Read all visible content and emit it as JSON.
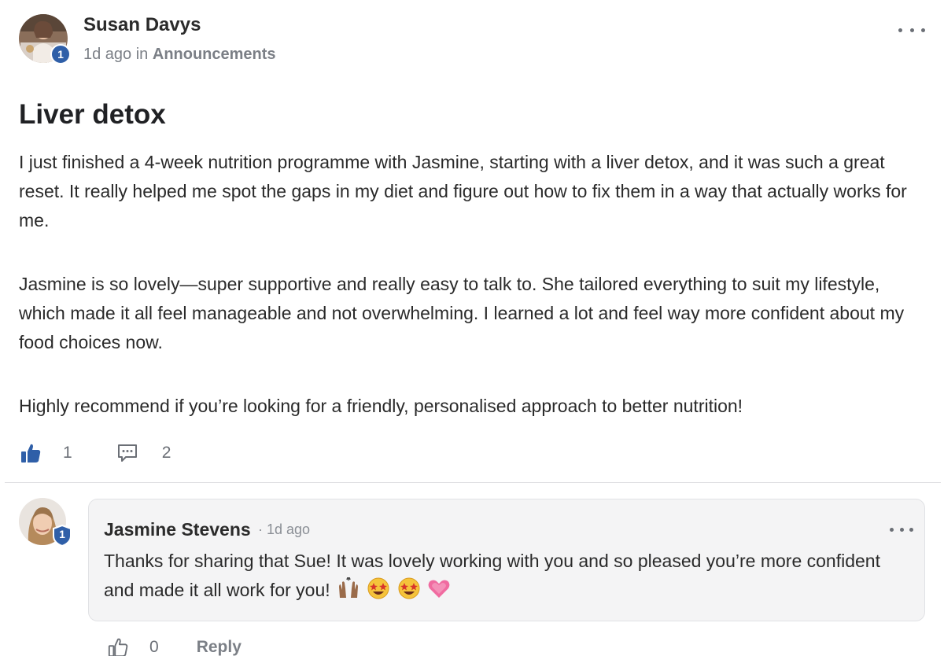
{
  "post": {
    "author": "Susan Davys",
    "author_level": "1",
    "time": "1d ago",
    "in_word": "in",
    "category": "Announcements",
    "title": "Liver detox",
    "paragraphs": [
      "I just finished a 4-week nutrition programme with Jasmine, starting with a liver detox, and it was such a great reset. It really helped me spot the gaps in my diet and figure out how to fix them in a way that actually works for me.",
      "Jasmine is so lovely—super supportive and really easy to talk to. She tailored everything to suit my lifestyle, which made it all feel manageable and not overwhelming. I learned a lot and feel way more confident about my food choices now.",
      "Highly recommend if you’re looking for a friendly, personalised approach to better nutrition!"
    ],
    "like_count": "1",
    "comment_count": "2"
  },
  "comment": {
    "author": "Jasmine Stevens",
    "author_level": "1",
    "time": "· 1d ago",
    "text": "Thanks for sharing that Sue! It was lovely working with you and so pleased you’re more confident and made it all work for you!",
    "emojis": [
      "raising-hands",
      "star-struck",
      "star-struck",
      "growing-heart"
    ],
    "like_count": "0",
    "reply_label": "Reply"
  },
  "colors": {
    "accent": "#2f5fa8",
    "like_active": "#2f5fa8",
    "muted_text": "#7b7f86",
    "comment_bg": "#f4f4f5"
  }
}
